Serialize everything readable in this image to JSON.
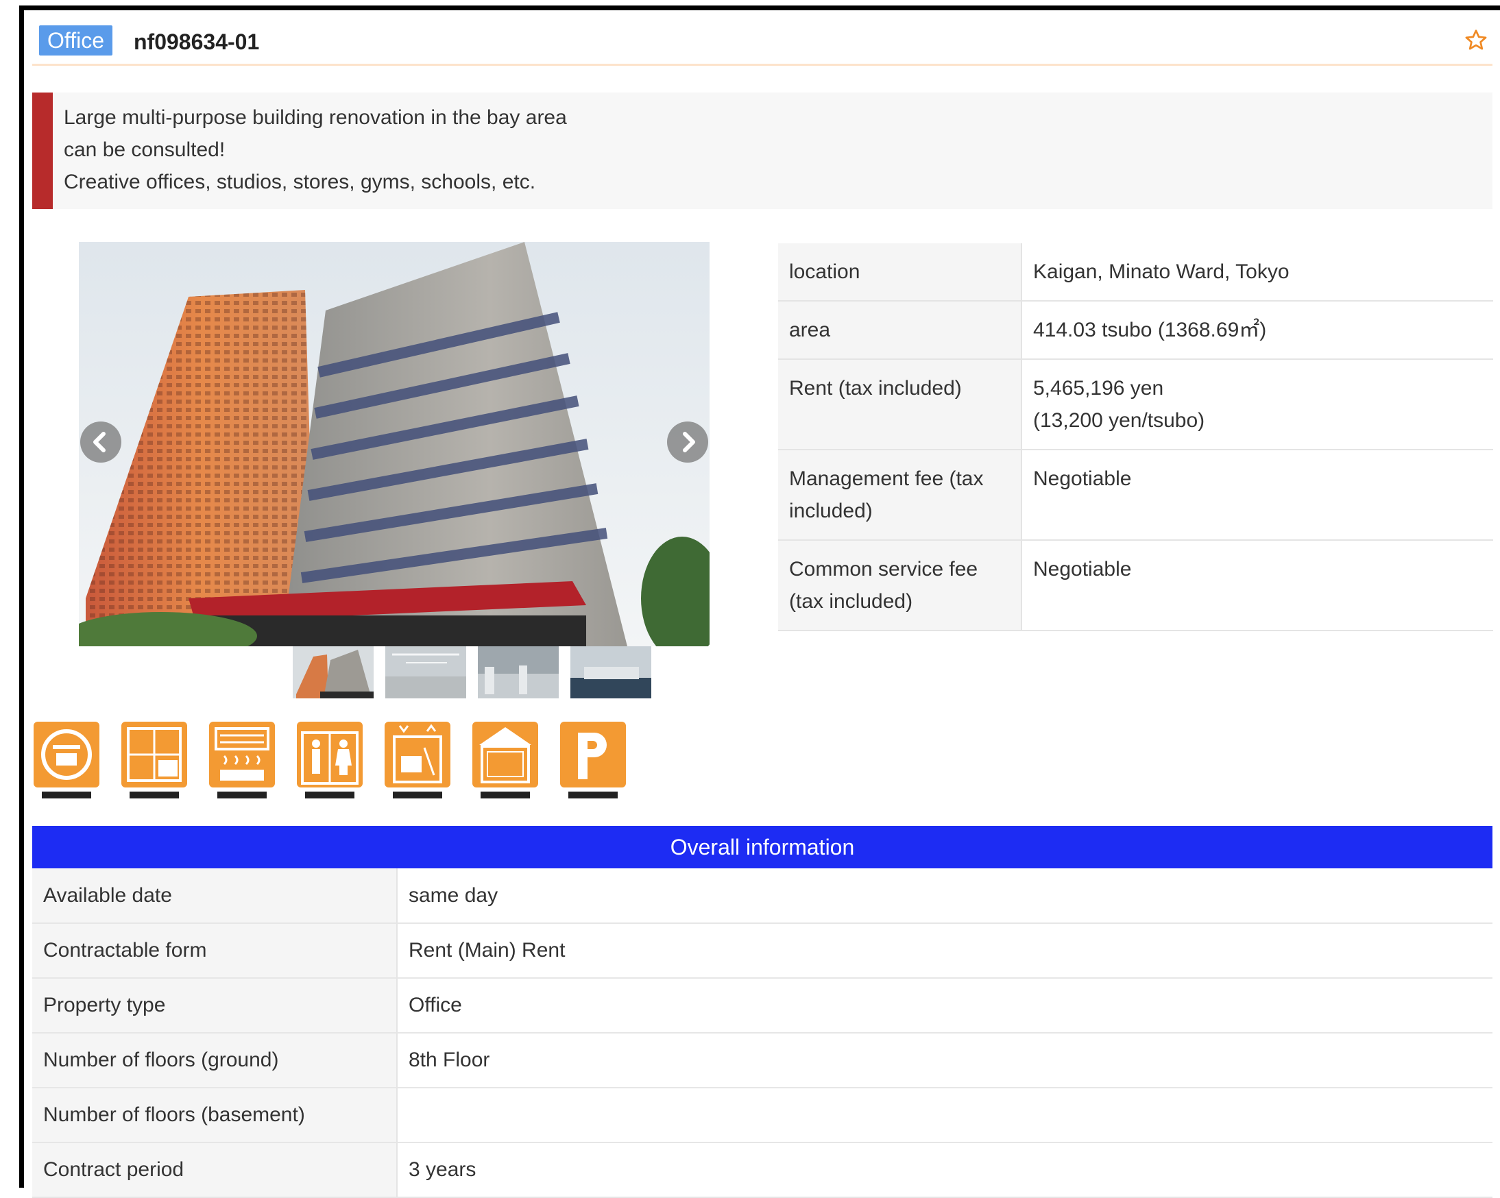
{
  "header": {
    "badge": "Office",
    "property_id": "nf098634-01",
    "favorite_icon": "star-outline-icon"
  },
  "catchcopy": {
    "lines": [
      "Large multi-purpose building renovation in the bay area",
      "can be consulted!",
      "Creative offices, studios, stores, gyms, schools, etc."
    ]
  },
  "gallery": {
    "prev_icon": "chevron-left-icon",
    "next_icon": "chevron-right-icon",
    "thumbnails": [
      "building-exterior",
      "interior-1",
      "interior-2",
      "interior-3"
    ]
  },
  "features": {
    "icons": [
      {
        "icon": "rental-icon",
        "label": "賃貸"
      },
      {
        "icon": "partition-ok-icon",
        "label": "間借り"
      },
      {
        "icon": "air-conditioning-icon",
        "label": "空調有"
      },
      {
        "icon": "toilet-icon",
        "label": "トイレ男女別"
      },
      {
        "icon": "elevator-icon",
        "label": "EV有"
      },
      {
        "icon": "ceiling-height-icon",
        "label": "天井高"
      },
      {
        "icon": "parking-icon",
        "label": "駐車場有"
      }
    ]
  },
  "summary": {
    "rows": [
      {
        "label": "location",
        "value": "Kaigan, Minato Ward, Tokyo"
      },
      {
        "label": "area",
        "value": "414.03 tsubo (1368.69㎡)"
      },
      {
        "label": "Rent (tax included)",
        "value": "5,465,196 yen",
        "value2": "(13,200 yen/tsubo)"
      },
      {
        "label": "Management fee (tax included)",
        "value": "Negotiable"
      },
      {
        "label": "Common service fee (tax included)",
        "value": "Negotiable"
      }
    ]
  },
  "overall": {
    "title": "Overall information",
    "rows": [
      {
        "label": "Available date",
        "value": "same day"
      },
      {
        "label": "Contractable form",
        "value": "Rent (Main) Rent"
      },
      {
        "label": "Property type",
        "value": "Office"
      },
      {
        "label": "Number of floors (ground)",
        "value": "8th Floor"
      },
      {
        "label": "Number of floors (basement)",
        "value": ""
      },
      {
        "label": "Contract period",
        "value": "3 years"
      }
    ]
  },
  "colors": {
    "accent_blue": "#1d2cf3",
    "badge_blue": "#5a9bea",
    "catch_red": "#b72b2b",
    "icon_orange": "#f39a33",
    "star_orange": "#f08a24"
  }
}
